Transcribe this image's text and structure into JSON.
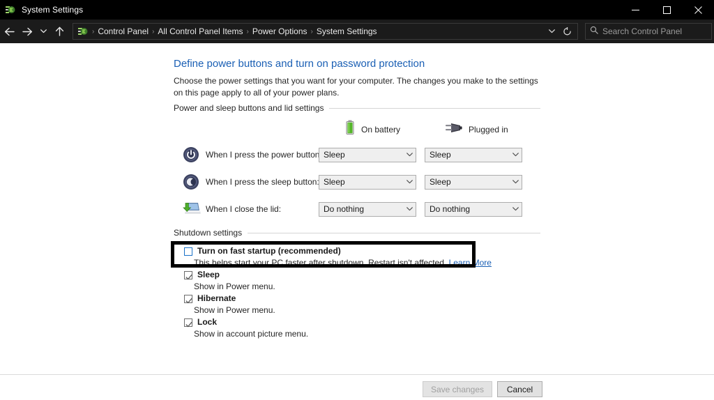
{
  "window": {
    "title": "System Settings",
    "icon": "control-panel-icon",
    "controls": {
      "minimize": "Minimize",
      "maximize": "Maximize",
      "close": "Close"
    }
  },
  "nav": {
    "back": "Back",
    "forward": "Forward",
    "recent": "Recent locations",
    "up": "Up one level",
    "breadcrumbs": [
      "Control Panel",
      "All Control Panel Items",
      "Power Options",
      "System Settings"
    ],
    "separator": "›",
    "dropdown": "Previous locations",
    "refresh": "Refresh"
  },
  "search": {
    "placeholder": "Search Control Panel",
    "icon": "search-icon"
  },
  "page": {
    "title": "Define power buttons and turn on password protection",
    "description": "Choose the power settings that you want for your computer. The changes you make to the settings on this page apply to all of your power plans."
  },
  "power_group": {
    "label": "Power and sleep buttons and lid settings",
    "columns": [
      {
        "label": "On battery",
        "icon": "battery-icon"
      },
      {
        "label": "Plugged in",
        "icon": "power-plug-icon"
      }
    ],
    "rows": [
      {
        "icon": "power-button-icon",
        "label": "When I press the power button:",
        "battery": "Sleep",
        "plugged": "Sleep"
      },
      {
        "icon": "sleep-button-icon",
        "label": "When I press the sleep button:",
        "battery": "Sleep",
        "plugged": "Sleep"
      },
      {
        "icon": "laptop-lid-icon",
        "label": "When I close the lid:",
        "battery": "Do nothing",
        "plugged": "Do nothing"
      }
    ]
  },
  "shutdown_group": {
    "label": "Shutdown settings",
    "items": [
      {
        "title": "Turn on fast startup (recommended)",
        "subtitle": "This helps start your PC faster after shutdown. Restart isn't affected.",
        "link": "Learn More",
        "checked": false,
        "highlighted": true
      },
      {
        "title": "Sleep",
        "subtitle": "Show in Power menu.",
        "checked": true,
        "highlighted": false
      },
      {
        "title": "Hibernate",
        "subtitle": "Show in Power menu.",
        "checked": true,
        "highlighted": false
      },
      {
        "title": "Lock",
        "subtitle": "Show in account picture menu.",
        "checked": true,
        "highlighted": false
      }
    ]
  },
  "footer": {
    "save": "Save changes",
    "save_enabled": false,
    "cancel": "Cancel"
  },
  "colors": {
    "titlebar": "#000000",
    "navbar": "#1b1b1b",
    "link": "#1a5fb4",
    "heading": "#1a5fb4",
    "annotation": "#000000",
    "battery_green": "#55b52a"
  }
}
